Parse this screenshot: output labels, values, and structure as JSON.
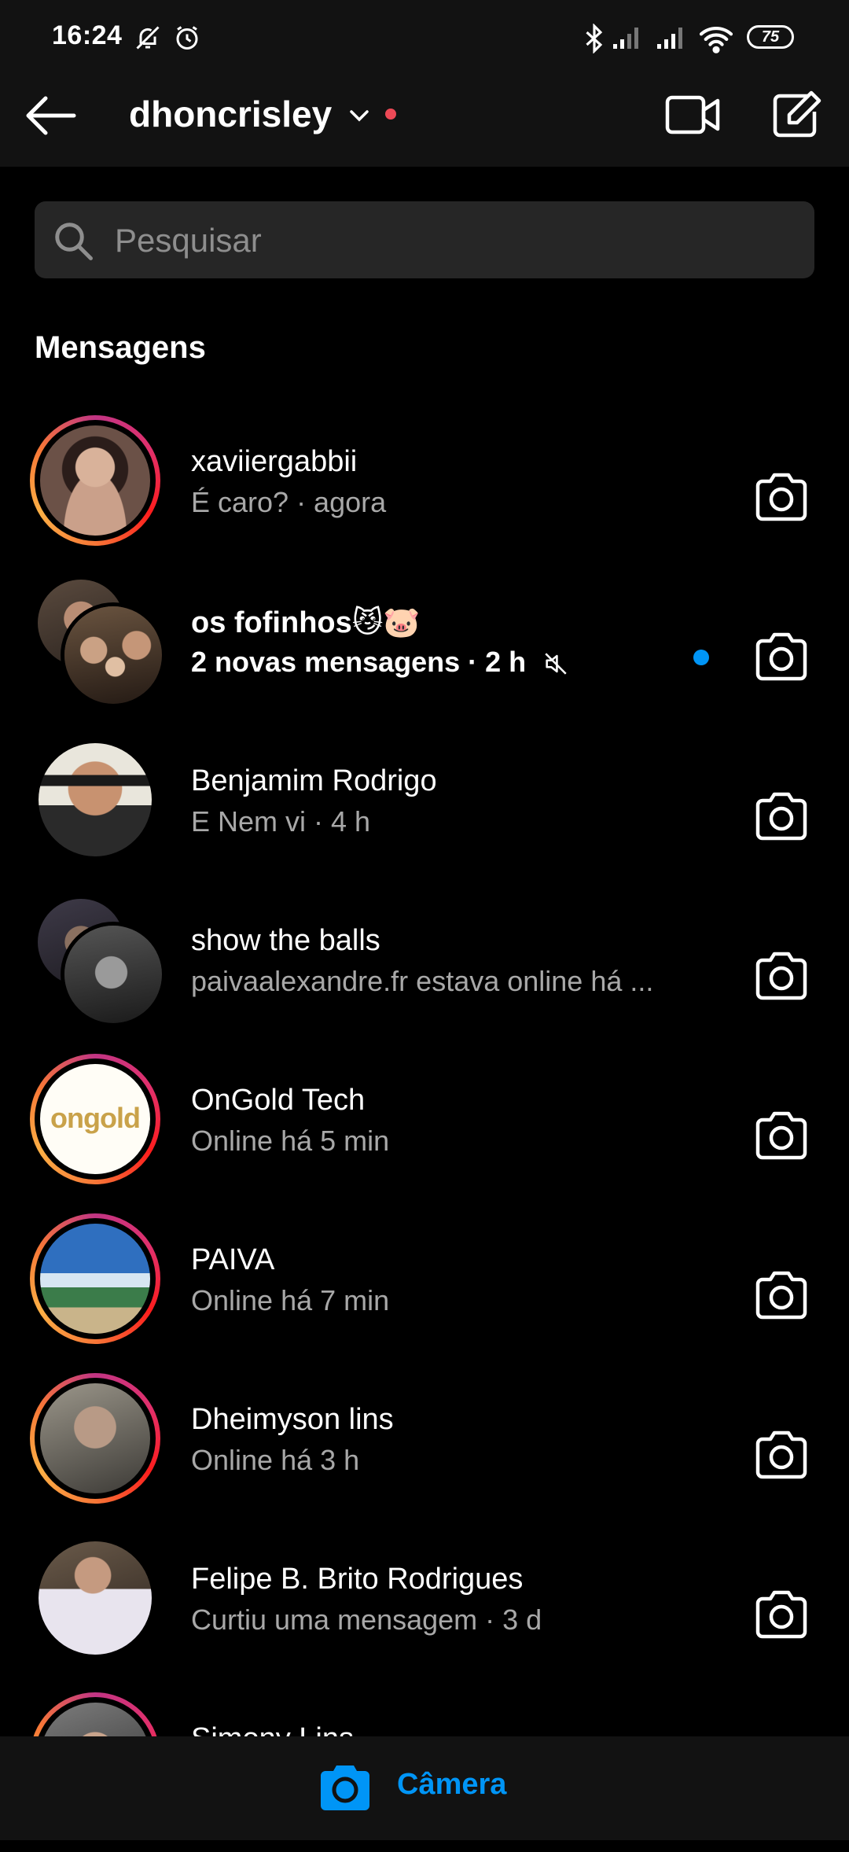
{
  "status_bar": {
    "time": "16:24",
    "battery": "75",
    "icons": [
      "notifications-muted-icon",
      "alarm-icon",
      "bluetooth-icon",
      "signal-icon",
      "signal-icon",
      "wifi-icon",
      "battery-icon"
    ]
  },
  "header": {
    "username": "dhoncrisley",
    "back_icon": "arrow-left-icon",
    "dropdown_icon": "chevron-down-icon",
    "video_icon": "video-camera-icon",
    "compose_icon": "edit-icon",
    "live_dot_color": "#ed4956"
  },
  "search": {
    "placeholder": "Pesquisar",
    "value": ""
  },
  "section_title": "Mensagens",
  "threads": [
    {
      "name": "xaviiergabbii",
      "sub": "É caro? · agora",
      "story_ring": true,
      "unread": false
    },
    {
      "name": "os fofinhos😼🐷",
      "sub": "2 novas mensagens · 2 h",
      "story_ring": false,
      "unread": true,
      "group": true,
      "muted": true
    },
    {
      "name": "Benjamim Rodrigo",
      "sub": "E Nem vi · 4 h",
      "story_ring": false,
      "unread": false
    },
    {
      "name": "show the balls",
      "sub": "paivaalexandre.fr estava online há ...",
      "story_ring": false,
      "unread": false,
      "group": true
    },
    {
      "name": "OnGold Tech",
      "sub": "Online há 5 min",
      "story_ring": true,
      "unread": false,
      "logo_text": "ongold"
    },
    {
      "name": "PAIVA",
      "sub": "Online há 7 min",
      "story_ring": true,
      "unread": false
    },
    {
      "name": "Dheimyson lins",
      "sub": "Online há 3 h",
      "story_ring": true,
      "unread": false
    },
    {
      "name": "Felipe B. Brito Rodrigues",
      "sub": "Curtiu uma mensagem · 3 d",
      "story_ring": false,
      "unread": false
    },
    {
      "name": "Simony Lins",
      "sub": "",
      "story_ring": true,
      "unread": false
    }
  ],
  "bottom_bar": {
    "camera_label": "Câmera",
    "camera_icon": "camera-icon",
    "accent_color": "#0095f6"
  }
}
